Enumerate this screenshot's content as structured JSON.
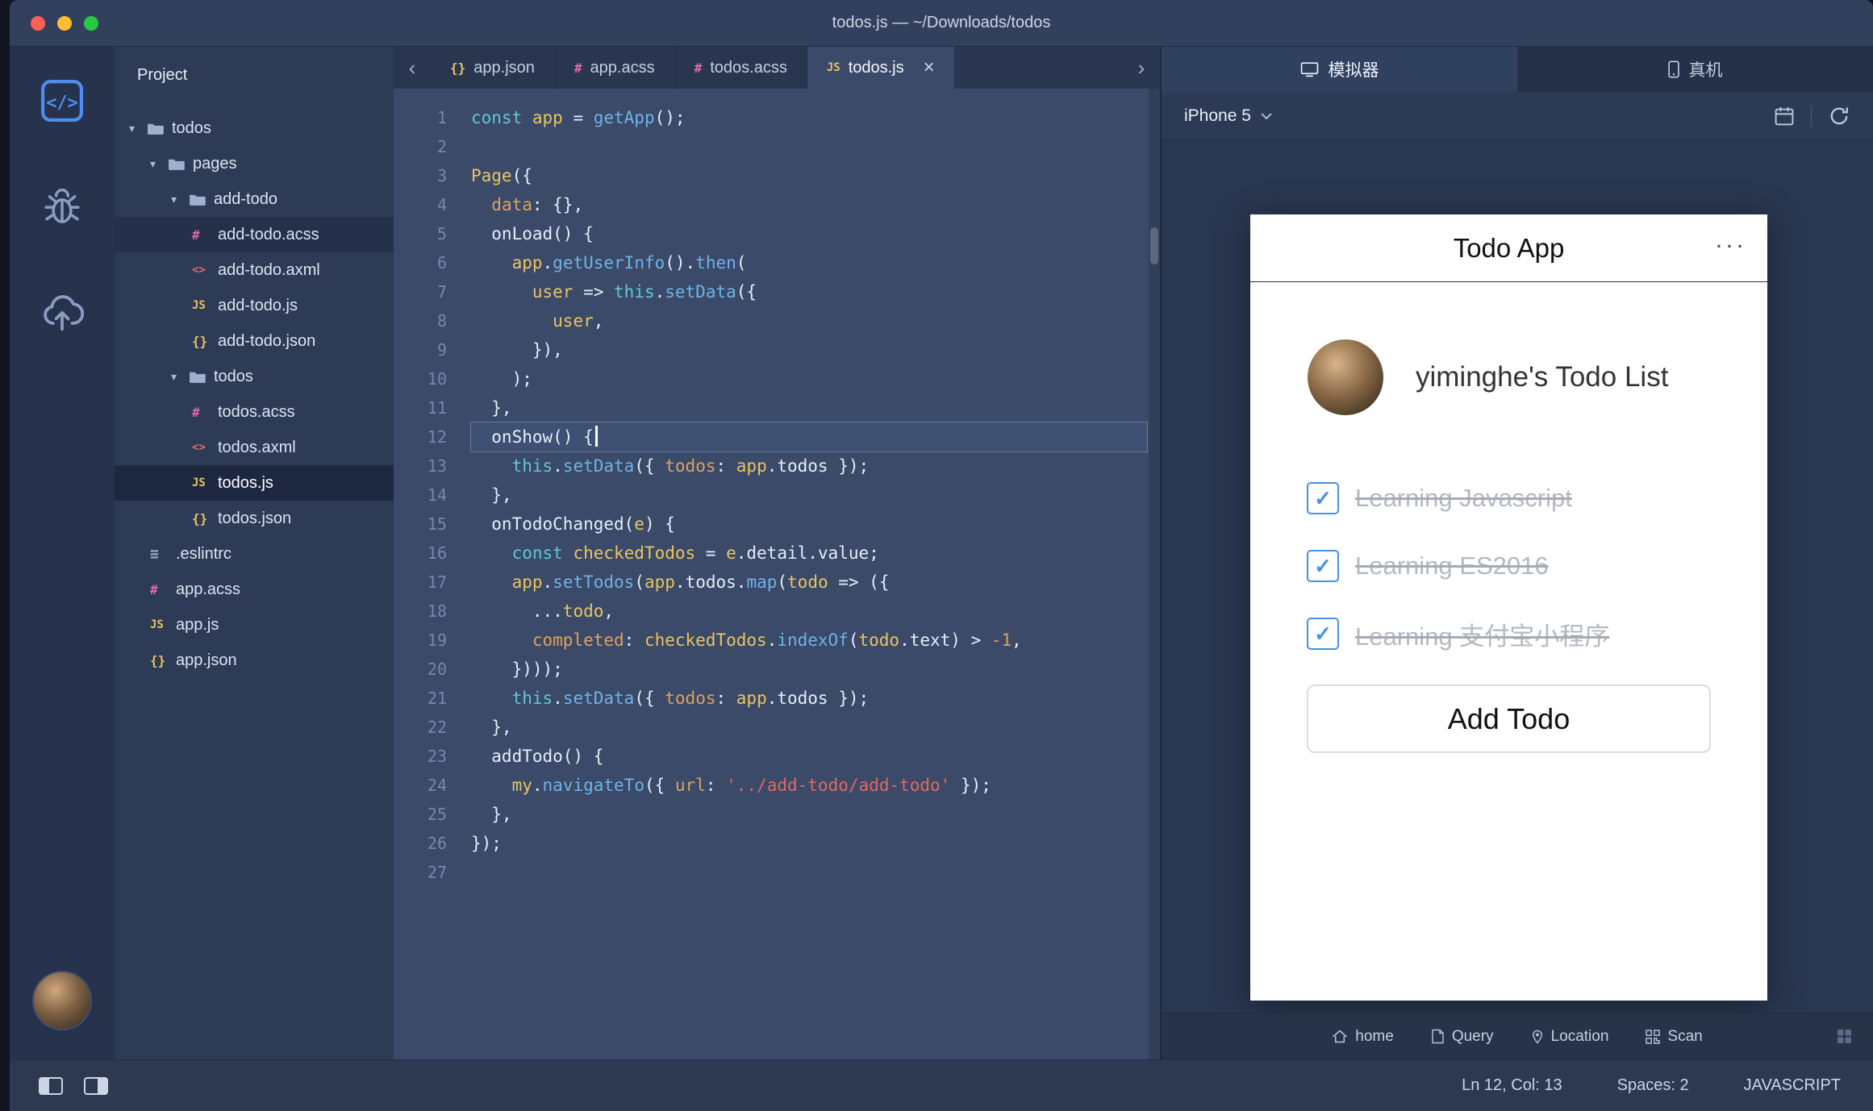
{
  "window": {
    "title": "todos.js — ~/Downloads/todos"
  },
  "icons": {
    "acss": "#",
    "axml": "<>",
    "js": "JS",
    "json": "{}",
    "eslint": "≡",
    "chevron_left": "‹",
    "chevron_right": "›",
    "arrow_down": "▾",
    "menu_dots": "···",
    "check": "✓",
    "close": "×"
  },
  "sidebar": {
    "header": "Project",
    "tree": [
      {
        "label": "todos",
        "type": "folder",
        "depth": 0
      },
      {
        "label": "pages",
        "type": "folder",
        "depth": 1
      },
      {
        "label": "add-todo",
        "type": "folder",
        "depth": 2
      },
      {
        "label": "add-todo.acss",
        "type": "acss",
        "depth": 3,
        "state": "hl"
      },
      {
        "label": "add-todo.axml",
        "type": "axml",
        "depth": 3
      },
      {
        "label": "add-todo.js",
        "type": "js",
        "depth": 3
      },
      {
        "label": "add-todo.json",
        "type": "json",
        "depth": 3
      },
      {
        "label": "todos",
        "type": "folder",
        "depth": 2
      },
      {
        "label": "todos.acss",
        "type": "acss",
        "depth": 3
      },
      {
        "label": "todos.axml",
        "type": "axml",
        "depth": 3
      },
      {
        "label": "todos.js",
        "type": "js",
        "depth": 3,
        "state": "sel"
      },
      {
        "label": "todos.json",
        "type": "json",
        "depth": 3
      },
      {
        "label": ".eslintrc",
        "type": "eslint",
        "depth": 1
      },
      {
        "label": "app.acss",
        "type": "acss",
        "depth": 1
      },
      {
        "label": "app.js",
        "type": "js",
        "depth": 1
      },
      {
        "label": "app.json",
        "type": "json",
        "depth": 1
      }
    ]
  },
  "tabs": [
    {
      "label": "app.json",
      "type": "json",
      "active": false
    },
    {
      "label": "app.acss",
      "type": "acss",
      "active": false
    },
    {
      "label": "todos.acss",
      "type": "acss",
      "active": false
    },
    {
      "label": "todos.js",
      "type": "js",
      "active": true
    }
  ],
  "editor": {
    "active_line": 12,
    "lines": [
      [
        [
          "k",
          "const "
        ],
        [
          "v",
          "app"
        ],
        [
          "d",
          " = "
        ],
        [
          "f",
          "getApp"
        ],
        [
          "d",
          "();"
        ]
      ],
      [],
      [
        [
          "v",
          "Page"
        ],
        [
          "d",
          "({"
        ]
      ],
      [
        [
          "d",
          "  "
        ],
        [
          "p",
          "data"
        ],
        [
          "d",
          ": {},"
        ]
      ],
      [
        [
          "d",
          "  onLoad() {"
        ]
      ],
      [
        [
          "d",
          "    "
        ],
        [
          "v",
          "app"
        ],
        [
          "d",
          "."
        ],
        [
          "f",
          "getUserInfo"
        ],
        [
          "d",
          "()."
        ],
        [
          "f",
          "then"
        ],
        [
          "d",
          "("
        ]
      ],
      [
        [
          "d",
          "      "
        ],
        [
          "v",
          "user"
        ],
        [
          "d",
          " => "
        ],
        [
          "k",
          "this"
        ],
        [
          "d",
          "."
        ],
        [
          "f",
          "setData"
        ],
        [
          "d",
          "({"
        ]
      ],
      [
        [
          "d",
          "        "
        ],
        [
          "v",
          "user"
        ],
        [
          "d",
          ","
        ]
      ],
      [
        [
          "d",
          "      }),"
        ]
      ],
      [
        [
          "d",
          "    );"
        ]
      ],
      [
        [
          "d",
          "  },"
        ]
      ],
      [
        [
          "d",
          "  onShow() {"
        ]
      ],
      [
        [
          "d",
          "    "
        ],
        [
          "k",
          "this"
        ],
        [
          "d",
          "."
        ],
        [
          "f",
          "setData"
        ],
        [
          "d",
          "({ "
        ],
        [
          "p",
          "todos"
        ],
        [
          "d",
          ": "
        ],
        [
          "v",
          "app"
        ],
        [
          "d",
          ".todos });"
        ]
      ],
      [
        [
          "d",
          "  },"
        ]
      ],
      [
        [
          "d",
          "  onTodoChanged("
        ],
        [
          "v",
          "e"
        ],
        [
          "d",
          ") {"
        ]
      ],
      [
        [
          "d",
          "    "
        ],
        [
          "k",
          "const "
        ],
        [
          "v",
          "checkedTodos"
        ],
        [
          "d",
          " = "
        ],
        [
          "v",
          "e"
        ],
        [
          "d",
          ".detail.value;"
        ]
      ],
      [
        [
          "d",
          "    "
        ],
        [
          "v",
          "app"
        ],
        [
          "d",
          "."
        ],
        [
          "f",
          "setTodos"
        ],
        [
          "d",
          "("
        ],
        [
          "v",
          "app"
        ],
        [
          "d",
          ".todos."
        ],
        [
          "f",
          "map"
        ],
        [
          "d",
          "("
        ],
        [
          "v",
          "todo"
        ],
        [
          "d",
          " => ({"
        ]
      ],
      [
        [
          "d",
          "      ..."
        ],
        [
          "v",
          "todo"
        ],
        [
          "d",
          ","
        ]
      ],
      [
        [
          "d",
          "      "
        ],
        [
          "p",
          "completed"
        ],
        [
          "d",
          ": "
        ],
        [
          "v",
          "checkedTodos"
        ],
        [
          "d",
          "."
        ],
        [
          "f",
          "indexOf"
        ],
        [
          "d",
          "("
        ],
        [
          "v",
          "todo"
        ],
        [
          "d",
          ".text) > "
        ],
        [
          "n",
          "-1"
        ],
        [
          "d",
          ","
        ]
      ],
      [
        [
          "d",
          "    })));"
        ]
      ],
      [
        [
          "d",
          "    "
        ],
        [
          "k",
          "this"
        ],
        [
          "d",
          "."
        ],
        [
          "f",
          "setData"
        ],
        [
          "d",
          "({ "
        ],
        [
          "p",
          "todos"
        ],
        [
          "d",
          ": "
        ],
        [
          "v",
          "app"
        ],
        [
          "d",
          ".todos });"
        ]
      ],
      [
        [
          "d",
          "  },"
        ]
      ],
      [
        [
          "d",
          "  addTodo() {"
        ]
      ],
      [
        [
          "d",
          "    "
        ],
        [
          "v",
          "my"
        ],
        [
          "d",
          "."
        ],
        [
          "f",
          "navigateTo"
        ],
        [
          "d",
          "({ "
        ],
        [
          "p",
          "url"
        ],
        [
          "d",
          ": "
        ],
        [
          "s",
          "'../add-todo/add-todo'"
        ],
        [
          "d",
          " });"
        ]
      ],
      [
        [
          "d",
          "  },"
        ]
      ],
      [
        [
          "d",
          "});"
        ]
      ],
      []
    ]
  },
  "simulator": {
    "tabs": [
      {
        "label": "模拟器",
        "icon": "monitor",
        "active": true
      },
      {
        "label": "真机",
        "icon": "phone",
        "active": false
      }
    ],
    "device": "iPhone 5",
    "app": {
      "title": "Todo App",
      "list_title": "yiminghe's Todo List",
      "todos": [
        {
          "text": "Learning Javascript",
          "done": true
        },
        {
          "text": "Learning ES2016",
          "done": true
        },
        {
          "text": "Learning 支付宝小程序",
          "done": true
        }
      ],
      "add_button": "Add Todo"
    },
    "footer": [
      {
        "icon": "home",
        "label": "home"
      },
      {
        "icon": "query",
        "label": "Query"
      },
      {
        "icon": "location",
        "label": "Location"
      },
      {
        "icon": "scan",
        "label": "Scan"
      }
    ]
  },
  "statusbar": {
    "position": "Ln 12, Col: 13",
    "spaces": "Spaces: 2",
    "language": "JAVASCRIPT"
  }
}
